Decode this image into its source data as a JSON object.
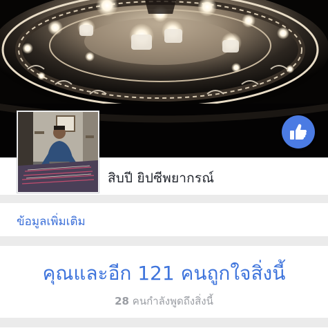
{
  "page": {
    "name": "สิบปี ยิปซีพยากรณ์"
  },
  "about": {
    "more_info_label": "ข้อมูลเพิ่มเติม"
  },
  "likes": {
    "summary": "คุณและอีก 121 คนถูกใจสิ่งนี้",
    "talking_count": "28",
    "talking_label": "คนกำลังพูดถึงสิ่งนี้"
  },
  "icons": {
    "like": "thumbs-up-icon"
  },
  "colors": {
    "accent": "#3e74dc",
    "like_button": "#4b7be3",
    "muted_text": "#9a9da3",
    "cover_dark": "#050403"
  }
}
